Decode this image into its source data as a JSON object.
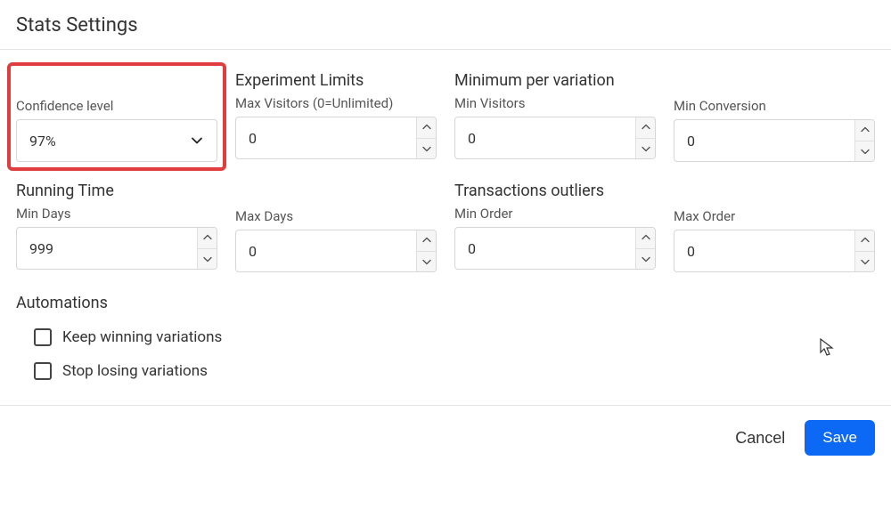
{
  "title": "Stats Settings",
  "row1": {
    "confidence_title": "Confidence level",
    "confidence_value": "97%",
    "experiment_limits_title": "Experiment Limits",
    "max_visitors_label": "Max Visitors (0=Unlimited)",
    "max_visitors_value": "0",
    "min_per_variation_title": "Minimum per variation",
    "min_visitors_label": "Min Visitors",
    "min_visitors_value": "0",
    "min_conversion_label": "Min Conversion",
    "min_conversion_value": "0"
  },
  "row2": {
    "running_time_title": "Running Time",
    "min_days_label": "Min Days",
    "min_days_value": "999",
    "max_days_label": "Max Days",
    "max_days_value": "0",
    "transactions_outliers_title": "Transactions outliers",
    "min_order_label": "Min Order",
    "min_order_value": "0",
    "max_order_label": "Max Order",
    "max_order_value": "0"
  },
  "automations": {
    "title": "Automations",
    "keep_winning_label": "Keep winning variations",
    "stop_losing_label": "Stop losing variations"
  },
  "footer": {
    "cancel_label": "Cancel",
    "save_label": "Save"
  }
}
